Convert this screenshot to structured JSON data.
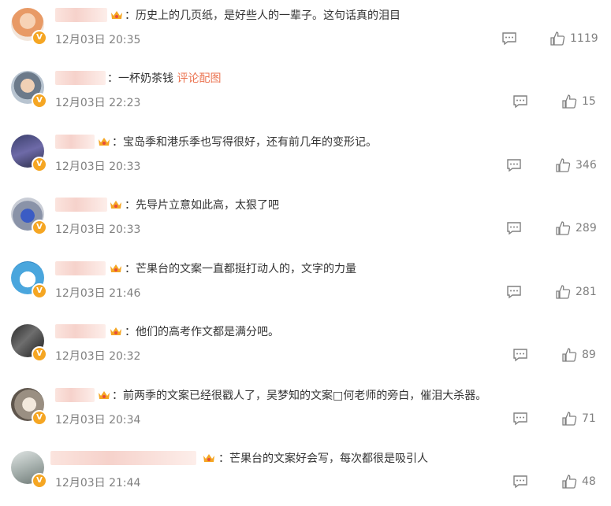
{
  "comments": [
    {
      "text": "：历史上的几页纸，是好些人的一辈子。这句话真的泪目",
      "link": "",
      "time": "12月03日 20:35",
      "likes": "1119"
    },
    {
      "text": "：一杯奶茶钱 ",
      "link": "评论配图",
      "time": "12月03日 22:23",
      "likes": "15"
    },
    {
      "text": "：宝岛季和港乐季也写得很好，还有前几年的变形记。",
      "link": "",
      "time": "12月03日 20:33",
      "likes": "346"
    },
    {
      "text": "：先导片立意如此高，太狠了吧",
      "link": "",
      "time": "12月03日 20:33",
      "likes": "289"
    },
    {
      "text": "：芒果台的文案一直都挺打动人的，文字的力量",
      "link": "",
      "time": "12月03日 21:46",
      "likes": "281"
    },
    {
      "text": "：他们的高考作文都是满分吧。",
      "link": "",
      "time": "12月03日 20:32",
      "likes": "89"
    },
    {
      "text": "：前两季的文案已经很戳人了，吴梦知的文案□何老师的旁白，催泪大杀器。",
      "link": "",
      "time": "12月03日 20:34",
      "likes": "71"
    },
    {
      "text": "：芒果台的文案好会写，每次都很是吸引人",
      "link": "",
      "time": "12月03日 21:44",
      "likes": "48"
    }
  ],
  "icons": {
    "comment": "comment-icon",
    "like": "thumbs-up-icon",
    "verified": "verified-badge-icon",
    "crown": "vip-crown-icon"
  },
  "colors": {
    "accent": "#eb7350",
    "badge": "#f5a623",
    "meta": "#808080"
  }
}
